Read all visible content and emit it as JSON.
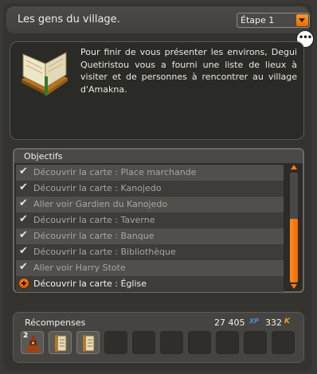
{
  "header": {
    "title": "Les gens du village.",
    "step_select": {
      "value": "Étape 1"
    }
  },
  "description": {
    "text": "Pour finir de vous présenter les environs, Degui Quetiristou vous a fourni une liste de lieux à visiter et de personnes à rencontrer au village d'Amakna."
  },
  "objectives": {
    "label": "Objectifs",
    "items": [
      {
        "text": "Découvrir la carte : Place marchande",
        "done": true
      },
      {
        "text": "Découvrir la carte : Kanojedo",
        "done": true
      },
      {
        "text": "Aller voir Gardien du Kanojedo",
        "done": true
      },
      {
        "text": "Découvrir la carte : Taverne",
        "done": true
      },
      {
        "text": "Découvrir la carte : Banque",
        "done": true
      },
      {
        "text": "Découvrir la carte : Bibliothèque",
        "done": true
      },
      {
        "text": "Aller voir Harry Stote",
        "done": true
      },
      {
        "text": "Découvrir la carte : Église",
        "done": false
      }
    ]
  },
  "rewards": {
    "label": "Récompenses",
    "xp": "27 405",
    "xp_unit": "XP",
    "kamas": "332",
    "kamas_unit": "K",
    "items": [
      {
        "icon": "costume-item-icon",
        "quantity": "2"
      },
      {
        "icon": "scroll-item-icon",
        "quantity": ""
      },
      {
        "icon": "scroll-item-icon",
        "quantity": ""
      }
    ],
    "empty_slots": 7
  },
  "colors": {
    "accent": "#f07a10",
    "panel": "#34332f",
    "xp": "#4a8cd8",
    "kamas": "#e8a21a"
  }
}
